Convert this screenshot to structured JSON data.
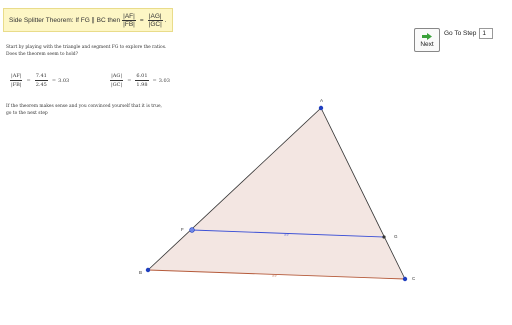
{
  "title_bar": {
    "prefix": "Side Splitter Theorem: If FG ∥ BC then",
    "frac1_num": "|AF|",
    "frac1_den": "|FB|",
    "eq": "=",
    "frac2_num": "|AG|",
    "frac2_den": "|GC|",
    "suffix": "."
  },
  "intro": {
    "line1": "Start by playing with the triangle and segment FG to explore the ratios.",
    "line2": "Does the theorem seem to hold?"
  },
  "ratio_left": {
    "num": "|AF|",
    "den": "|FB|",
    "num_val": "7.41",
    "den_val": "2.45",
    "result": "3.03"
  },
  "ratio_right": {
    "num": "|AG|",
    "den": "|GC|",
    "num_val": "6.01",
    "den_val": "1.98",
    "result": "3.03"
  },
  "followup": {
    "line1": "If the theorem makes sense and you convinced yourself that it is true,",
    "line2": "go to the next step"
  },
  "controls": {
    "next_label": "Next",
    "goto_label": "Go To Step",
    "step_value": "1"
  },
  "points": {
    "A": "A",
    "B": "B",
    "C": "C",
    "F": "F",
    "G": "G"
  },
  "colors": {
    "triangle_fill": "#f3e6e2",
    "triangle_edge": "#333333",
    "bc_edge": "#b55a3a",
    "fg_line": "#3a4fd6",
    "point": "#1f3fbf",
    "next_arrow": "#3aa13a"
  }
}
